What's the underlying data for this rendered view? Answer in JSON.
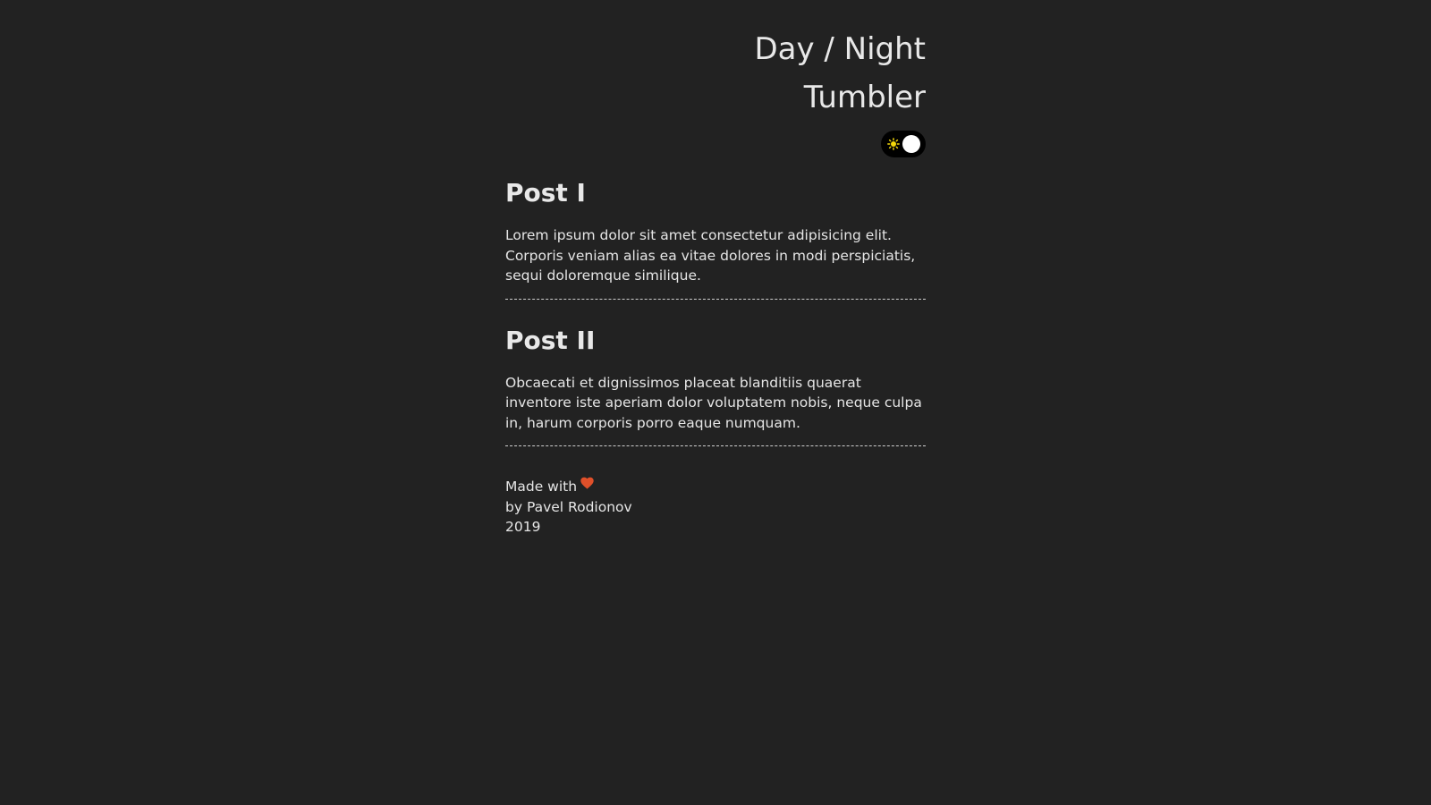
{
  "header": {
    "title_line1": "Day / Night",
    "title_line2": "Tumbler",
    "toggle": {
      "state": "night",
      "icon": "sun-icon",
      "track_color": "#000000",
      "knob_color": "#ffffff",
      "sun_color": "#f5d90a"
    }
  },
  "posts": [
    {
      "title": "Post I",
      "body": "Lorem ipsum dolor sit amet consectetur adipisicing elit. Corporis veniam alias ea vitae dolores in modi perspiciatis, sequi doloremque similique."
    },
    {
      "title": "Post II",
      "body": "Obcaecati et dignissimos placeat blanditiis quaerat inventore iste aperiam dolor voluptatem nobis, neque culpa in, harum corporis porro eaque numquam."
    }
  ],
  "footer": {
    "made_with": "Made with",
    "heart_icon": "heart-icon",
    "heart_color": "#e0502a",
    "author": "by Pavel Rodionov",
    "year": "2019"
  },
  "theme": {
    "background": "#222222",
    "text": "#e6e6e6"
  }
}
